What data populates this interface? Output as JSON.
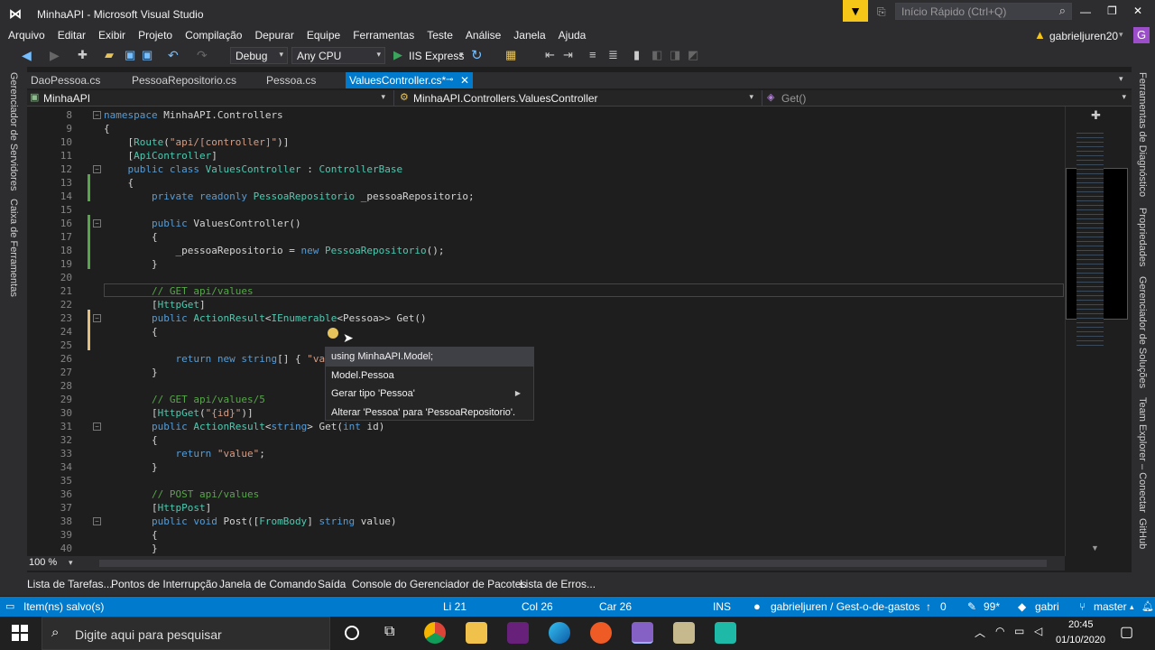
{
  "window": {
    "title": "MinhaAPI - Microsoft Visual Studio",
    "quick_launch": "Início Rápido (Ctrl+Q)",
    "user": "gabrieljuren20",
    "user_initial": "G"
  },
  "menu": [
    "Arquivo",
    "Editar",
    "Exibir",
    "Projeto",
    "Compilação",
    "Depurar",
    "Equipe",
    "Ferramentas",
    "Teste",
    "Análise",
    "Janela",
    "Ajuda"
  ],
  "toolbar": {
    "config": "Debug",
    "platform": "Any CPU",
    "run": "IIS Express"
  },
  "tabs": [
    "DaoPessoa.cs",
    "PessoaRepositorio.cs",
    "Pessoa.cs",
    "ValuesController.cs*"
  ],
  "nav": {
    "project": "MinhaAPI",
    "class": "MinhaAPI.Controllers.ValuesController",
    "member": "Get()"
  },
  "left_dock": [
    "Gerenciador de Servidores",
    "Caixa de Ferramentas"
  ],
  "right_dock": [
    "Ferramentas de Diagnóstico",
    "Propriedades",
    "Gerenciador de Soluções",
    "Team Explorer – Conectar",
    "GitHub"
  ],
  "lines": [
    {
      "n": "8",
      "html": "<span class=\"kw\">namespace</span> MinhaAPI.Controllers"
    },
    {
      "n": "9",
      "html": "{"
    },
    {
      "n": "10",
      "html": "    [<span class=\"at\">Route</span>(<span class=\"st\">\"api/[controller]\"</span>)]"
    },
    {
      "n": "11",
      "html": "    [<span class=\"at\">ApiController</span>]"
    },
    {
      "n": "12",
      "html": "    <span class=\"kw\">public class</span> <span class=\"ty\">ValuesController</span> : <span class=\"ty\">ControllerBase</span>"
    },
    {
      "n": "13",
      "html": "    {"
    },
    {
      "n": "14",
      "html": "        <span class=\"kw\">private readonly</span> <span class=\"ty\">PessoaRepositorio</span> _pessoaRepositorio;"
    },
    {
      "n": "15",
      "html": ""
    },
    {
      "n": "16",
      "html": "        <span class=\"kw\">public</span> ValuesController()"
    },
    {
      "n": "17",
      "html": "        {"
    },
    {
      "n": "18",
      "html": "            _pessoaRepositorio = <span class=\"kw\">new</span> <span class=\"ty\">PessoaRepositorio</span>();"
    },
    {
      "n": "19",
      "html": "        }"
    },
    {
      "n": "20",
      "html": ""
    },
    {
      "n": "21",
      "html": "        <span class=\"cm\">// GET api/values</span>"
    },
    {
      "n": "22",
      "html": "        [<span class=\"at\">HttpGet</span>]"
    },
    {
      "n": "23",
      "html": "        <span class=\"kw\">public</span> <span class=\"ty\">ActionResult</span>&lt;<span class=\"ty\">IEnumerable</span>&lt;Pessoa&gt;&gt; Get()"
    },
    {
      "n": "24",
      "html": "        {"
    },
    {
      "n": "25",
      "html": ""
    },
    {
      "n": "26",
      "html": "            <span class=\"kw\">return</span> <span class=\"kw\">new</span> <span class=\"kw\">string</span>[] { <span class=\"st\">\"va</span>"
    },
    {
      "n": "27",
      "html": "        }"
    },
    {
      "n": "28",
      "html": ""
    },
    {
      "n": "29",
      "html": "        <span class=\"cm\">// GET api/values/5</span>"
    },
    {
      "n": "30",
      "html": "        [<span class=\"at\">HttpGet</span>(<span class=\"st\">\"{id}\"</span>)]"
    },
    {
      "n": "31",
      "html": "        <span class=\"kw\">public</span> <span class=\"ty\">ActionResult</span>&lt;<span class=\"kw\">string</span>&gt; Get(<span class=\"kw\">int</span> id)"
    },
    {
      "n": "32",
      "html": "        {"
    },
    {
      "n": "33",
      "html": "            <span class=\"kw\">return</span> <span class=\"st\">\"value\"</span>;"
    },
    {
      "n": "34",
      "html": "        }"
    },
    {
      "n": "35",
      "html": ""
    },
    {
      "n": "36",
      "html": "        <span class=\"cm\">// POST api/values</span>"
    },
    {
      "n": "37",
      "html": "        [<span class=\"at\">HttpPost</span>]"
    },
    {
      "n": "38",
      "html": "        <span class=\"kw\">public void</span> Post([<span class=\"at\">FromBody</span>] <span class=\"kw\">string</span> value)"
    },
    {
      "n": "39",
      "html": "        {"
    },
    {
      "n": "40",
      "html": "        }"
    }
  ],
  "quick_actions": [
    "using MinhaAPI.Model;",
    "Model.Pessoa",
    "Gerar tipo 'Pessoa'",
    "Alterar 'Pessoa' para 'PessoaRepositorio'."
  ],
  "zoom": "100 %",
  "bottom_tabs": [
    "Lista de Tarefas...",
    "Pontos de Interrupção",
    "Janela de Comando",
    "Saída",
    "Console do Gerenciador de Pacotes",
    "Lista de Erros..."
  ],
  "status": {
    "message": "Item(ns) salvo(s)",
    "line": "Li 21",
    "col": "Col 26",
    "car": "Car 26",
    "mode": "INS",
    "repo": "gabrieljuren / Gest-o-de-gastos",
    "changes": "0",
    "pending": "99*",
    "user": "gabri",
    "branch": "master"
  },
  "taskbar": {
    "search": "Digite aqui para pesquisar",
    "time": "20:45",
    "date": "01/10/2020"
  }
}
